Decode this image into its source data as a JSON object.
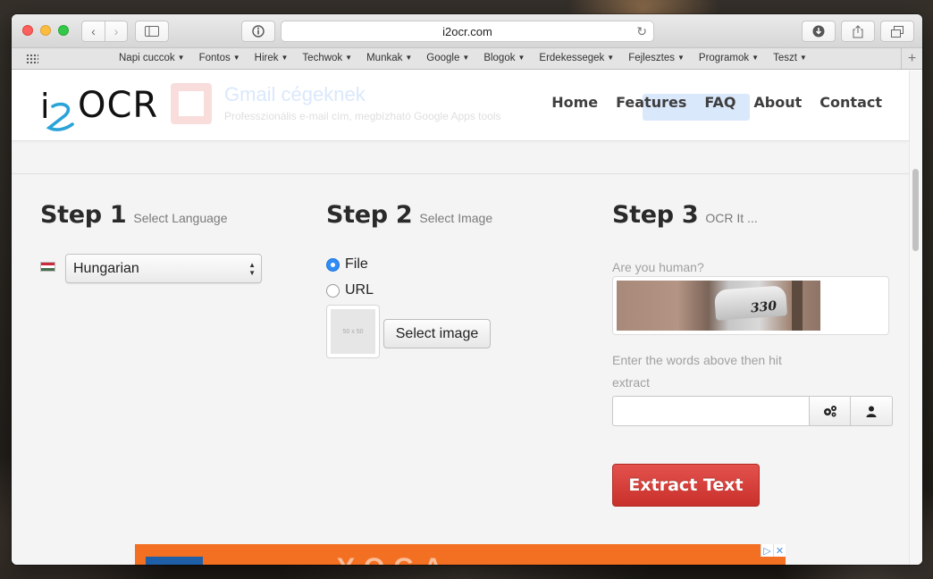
{
  "browser": {
    "url": "i2ocr.com",
    "bookmarks": [
      "Napi cuccok",
      "Fontos",
      "Hirek",
      "Techwok",
      "Munkak",
      "Google",
      "Blogok",
      "Erdekessegek",
      "Fejlesztes",
      "Programok",
      "Teszt"
    ]
  },
  "header": {
    "logo_i": "i",
    "logo_ocr": "OCR",
    "nav": [
      "Home",
      "Features",
      "FAQ",
      "About",
      "Contact"
    ],
    "ghost_ad": {
      "title": "Gmail cégeknek",
      "subtitle": "Professzionális e-mail cím, megbízható Google Apps tools"
    }
  },
  "step1": {
    "title": "Step 1",
    "subtitle": "Select Language",
    "language": "Hungarian"
  },
  "step2": {
    "title": "Step 2",
    "subtitle": "Select Image",
    "radio_file": "File",
    "radio_url": "URL",
    "selected": "File",
    "thumb_placeholder": "50 x 50",
    "select_button": "Select image"
  },
  "step3": {
    "title": "Step 3",
    "subtitle": "OCR It ...",
    "human_label": "Are you human?",
    "captcha_number": "330",
    "enter_label": "Enter the words above then hit extract",
    "input_value": "",
    "extract_button": "Extract Text"
  },
  "bottom_ad": {
    "text": "YOGA"
  },
  "colors": {
    "extract_bg": "#d63f3a",
    "radio_on": "#2f8df5",
    "ad_orange": "#f36f21"
  }
}
